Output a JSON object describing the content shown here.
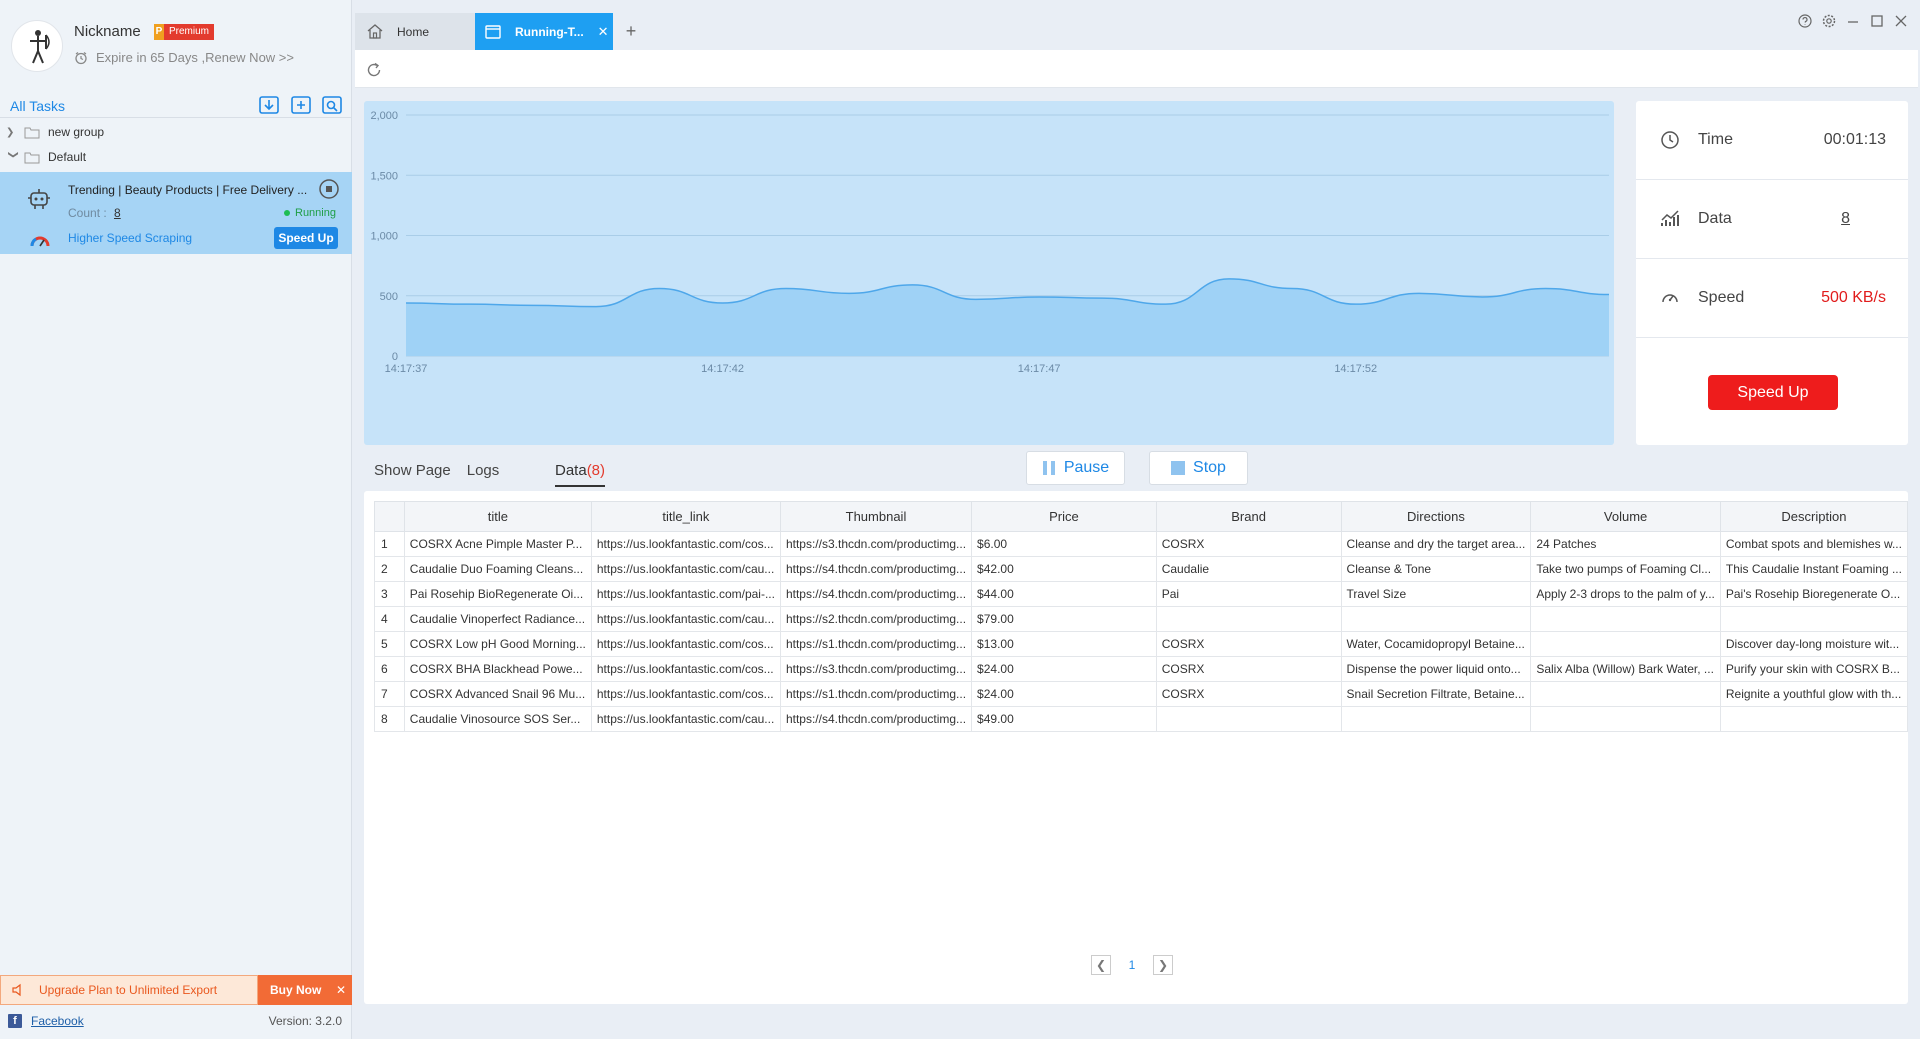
{
  "profile": {
    "nickname": "Nickname",
    "badge_p": "P",
    "badge_text": "Premium",
    "expire": "Expire in 65 Days ,Renew Now >>"
  },
  "sidebar": {
    "all_tasks": "All Tasks",
    "tree": [
      {
        "label": "new group",
        "expanded": false
      },
      {
        "label": "Default",
        "expanded": true
      }
    ],
    "task": {
      "title": "Trending | Beauty Products | Free Delivery ...",
      "count_label": "Count :",
      "count": "8",
      "status": "Running",
      "speed_label": "Higher Speed Scraping",
      "speedup_label": "Speed Up"
    },
    "upgrade_text": "Upgrade Plan to Unlimited Export",
    "buy_now": "Buy Now",
    "facebook": "Facebook",
    "version": "Version: 3.2.0"
  },
  "tabs": {
    "home": "Home",
    "running": "Running-T..."
  },
  "chart_data": {
    "type": "area",
    "y_ticks": [
      "0",
      "500",
      "1,000",
      "1,500",
      "2,000"
    ],
    "x_ticks": [
      "14:17:37",
      "14:17:42",
      "14:17:47",
      "14:17:52"
    ],
    "ylim": [
      0,
      2000
    ],
    "x_range": [
      "14:17:37",
      "14:17:56"
    ],
    "x": [
      "14:17:37",
      "14:17:38",
      "14:17:39",
      "14:17:40",
      "14:17:41",
      "14:17:42",
      "14:17:43",
      "14:17:44",
      "14:17:45",
      "14:17:46",
      "14:17:47",
      "14:17:48",
      "14:17:49",
      "14:17:50",
      "14:17:51",
      "14:17:52",
      "14:17:53",
      "14:17:54",
      "14:17:55",
      "14:17:56"
    ],
    "values": [
      440,
      430,
      420,
      410,
      560,
      440,
      560,
      520,
      590,
      470,
      490,
      480,
      430,
      640,
      560,
      430,
      520,
      490,
      560,
      510
    ],
    "grid": true,
    "colors": {
      "fill": "#9fd2f6",
      "line": "#4ea7ea",
      "background": "#c6e3f9"
    }
  },
  "stats": {
    "time_label": "Time",
    "time_value": "00:01:13",
    "data_label": "Data",
    "data_value": "8",
    "speed_label": "Speed",
    "speed_value": "500 KB/s",
    "speedup": "Speed Up"
  },
  "content_tabs": {
    "show_page": "Show Page",
    "logs": "Logs",
    "data": "Data",
    "data_count": "(8)"
  },
  "controls": {
    "pause": "Pause",
    "stop": "Stop"
  },
  "table": {
    "columns": [
      "",
      "title",
      "title_link",
      "Thumbnail",
      "Price",
      "Brand",
      "Directions",
      "Volume",
      "Description"
    ],
    "rows": [
      [
        "1",
        "COSRX Acne Pimple Master P...",
        "https://us.lookfantastic.com/cos...",
        "https://s3.thcdn.com/productimg...",
        "$6.00",
        "COSRX",
        "Cleanse and dry the target area...",
        "24 Patches",
        "Combat spots and blemishes w..."
      ],
      [
        "2",
        "Caudalie Duo Foaming Cleans...",
        "https://us.lookfantastic.com/cau...",
        "https://s4.thcdn.com/productimg...",
        "$42.00",
        "Caudalie",
        "Cleanse & Tone",
        "Take two pumps of Foaming Cl...",
        "This Caudalie Instant Foaming ..."
      ],
      [
        "3",
        "Pai Rosehip BioRegenerate Oi...",
        "https://us.lookfantastic.com/pai-...",
        "https://s4.thcdn.com/productimg...",
        "$44.00",
        "Pai",
        "Travel Size",
        "Apply 2-3 drops to the palm of y...",
        "Pai's Rosehip Bioregenerate O..."
      ],
      [
        "4",
        "Caudalie Vinoperfect Radiance...",
        "https://us.lookfantastic.com/cau...",
        "https://s2.thcdn.com/productimg...",
        "$79.00",
        "",
        "",
        "",
        ""
      ],
      [
        "5",
        "COSRX Low pH Good Morning...",
        "https://us.lookfantastic.com/cos...",
        "https://s1.thcdn.com/productimg...",
        "$13.00",
        "COSRX",
        "Water, Cocamidopropyl Betaine...",
        "",
        "Discover day-long moisture wit..."
      ],
      [
        "6",
        "COSRX BHA Blackhead Powe...",
        "https://us.lookfantastic.com/cos...",
        "https://s3.thcdn.com/productimg...",
        "$24.00",
        "COSRX",
        "Dispense the power liquid onto...",
        "Salix Alba (Willow) Bark Water, ...",
        "Purify your skin with COSRX B..."
      ],
      [
        "7",
        "COSRX Advanced Snail 96 Mu...",
        "https://us.lookfantastic.com/cos...",
        "https://s1.thcdn.com/productimg...",
        "$24.00",
        "COSRX",
        "Snail Secretion Filtrate, Betaine...",
        "",
        "Reignite a youthful glow with th..."
      ],
      [
        "8",
        "Caudalie Vinosource SOS Ser...",
        "https://us.lookfantastic.com/cau...",
        "https://s4.thcdn.com/productimg...",
        "$49.00",
        "",
        "",
        "",
        ""
      ]
    ]
  },
  "pager": {
    "page": "1"
  }
}
